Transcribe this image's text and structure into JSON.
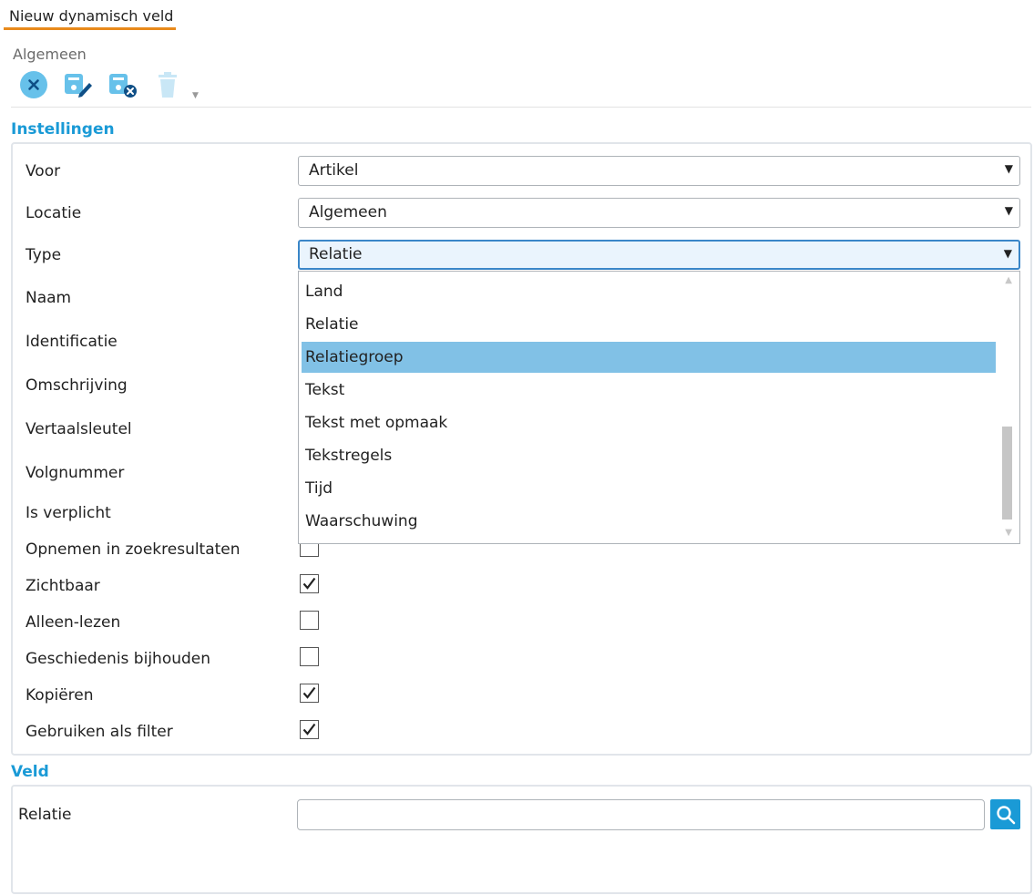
{
  "tab": {
    "label": "Nieuw dynamisch veld"
  },
  "ribbon": {
    "group_label": "Algemeen",
    "buttons": [
      {
        "icon": "cancel-icon"
      },
      {
        "icon": "save-edit-icon"
      },
      {
        "icon": "save-close-icon"
      },
      {
        "icon": "delete-icon",
        "disabled": true
      }
    ]
  },
  "instellingen": {
    "title": "Instellingen",
    "voor": {
      "label": "Voor",
      "value": "Artikel"
    },
    "locatie": {
      "label": "Locatie",
      "value": "Algemeen"
    },
    "type": {
      "label": "Type",
      "value": "Relatie",
      "options": [
        "Land",
        "Relatie",
        "Relatiegroep",
        "Tekst",
        "Tekst met opmaak",
        "Tekstregels",
        "Tijd",
        "Waarschuwing"
      ],
      "highlighted": "Relatiegroep"
    },
    "naam": {
      "label": "Naam"
    },
    "identificatie": {
      "label": "Identificatie"
    },
    "omschrijving": {
      "label": "Omschrijving"
    },
    "vertaalsleutel": {
      "label": "Vertaalsleutel"
    },
    "volgnummer": {
      "label": "Volgnummer"
    },
    "is_verplicht": {
      "label": "Is verplicht"
    },
    "opnemen": {
      "label": "Opnemen in zoekresultaten",
      "checked": false
    },
    "zichtbaar": {
      "label": "Zichtbaar",
      "checked": true
    },
    "alleen_lezen": {
      "label": "Alleen-lezen",
      "checked": false
    },
    "geschiedenis": {
      "label": "Geschiedenis bijhouden",
      "checked": false
    },
    "kopieren": {
      "label": "Kopiëren",
      "checked": true
    },
    "filter": {
      "label": "Gebruiken als filter",
      "checked": true
    }
  },
  "veld": {
    "title": "Veld",
    "relatie": {
      "label": "Relatie",
      "value": ""
    }
  },
  "colors": {
    "accent": "#1a9ad6",
    "tab_underline": "#e88a1c",
    "highlight": "#81c1e6"
  }
}
